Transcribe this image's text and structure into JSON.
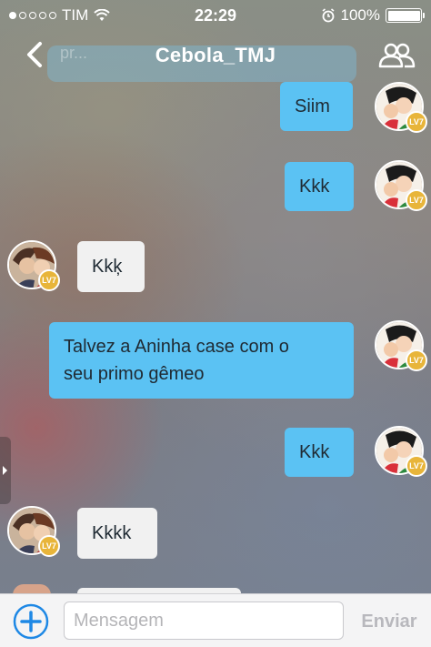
{
  "status_bar": {
    "carrier": "TIM",
    "time": "22:29",
    "battery": "100%",
    "signal_bars_filled": 1,
    "signal_bars_total": 5
  },
  "header": {
    "title": "Cebola_TMJ",
    "back_icon": "chevron-left-icon",
    "members_icon": "group-icon"
  },
  "ghost_text": "pr...",
  "messages": [
    {
      "direction": "out",
      "text": "Siim",
      "level": "LV7"
    },
    {
      "direction": "out",
      "text": "Kkk",
      "level": "LV7"
    },
    {
      "direction": "in",
      "text": "Kkķ",
      "level": "LV7"
    },
    {
      "direction": "out",
      "text_line1": "Talvez a Aninha case com o",
      "text_line2": "seu primo gêmeo",
      "level": "LV7"
    },
    {
      "direction": "out",
      "text": "Kkk",
      "level": "LV7"
    },
    {
      "direction": "in",
      "text": "Kkkk",
      "level": "LV7"
    }
  ],
  "composer": {
    "placeholder": "Mensagem",
    "send_label": "Enviar",
    "add_icon": "plus-circle-icon"
  },
  "colors": {
    "outgoing_bubble": "#5bc2f3",
    "incoming_bubble": "#f1f1f1",
    "accent": "#1e88e5",
    "level_badge": "#e8b53a"
  }
}
